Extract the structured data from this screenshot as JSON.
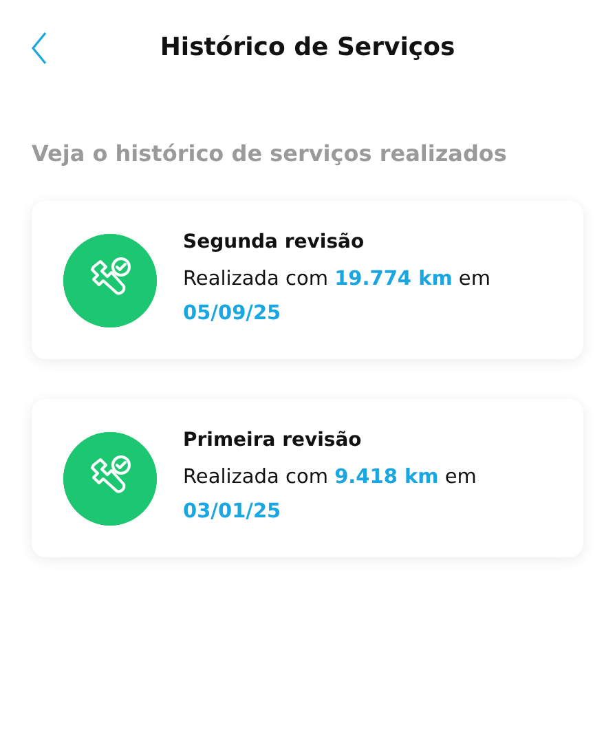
{
  "header": {
    "title": "Histórico de Serviços"
  },
  "subtitle": "Veja o histórico de serviços realizados",
  "services": [
    {
      "title": "Segunda revisão",
      "prefix": "Realizada com",
      "mileage": "19.774 km",
      "suffix": "em",
      "date": "05/09/25"
    },
    {
      "title": "Primeira revisão",
      "prefix": "Realizada com",
      "mileage": "9.418 km",
      "suffix": "em",
      "date": "03/01/25"
    }
  ]
}
